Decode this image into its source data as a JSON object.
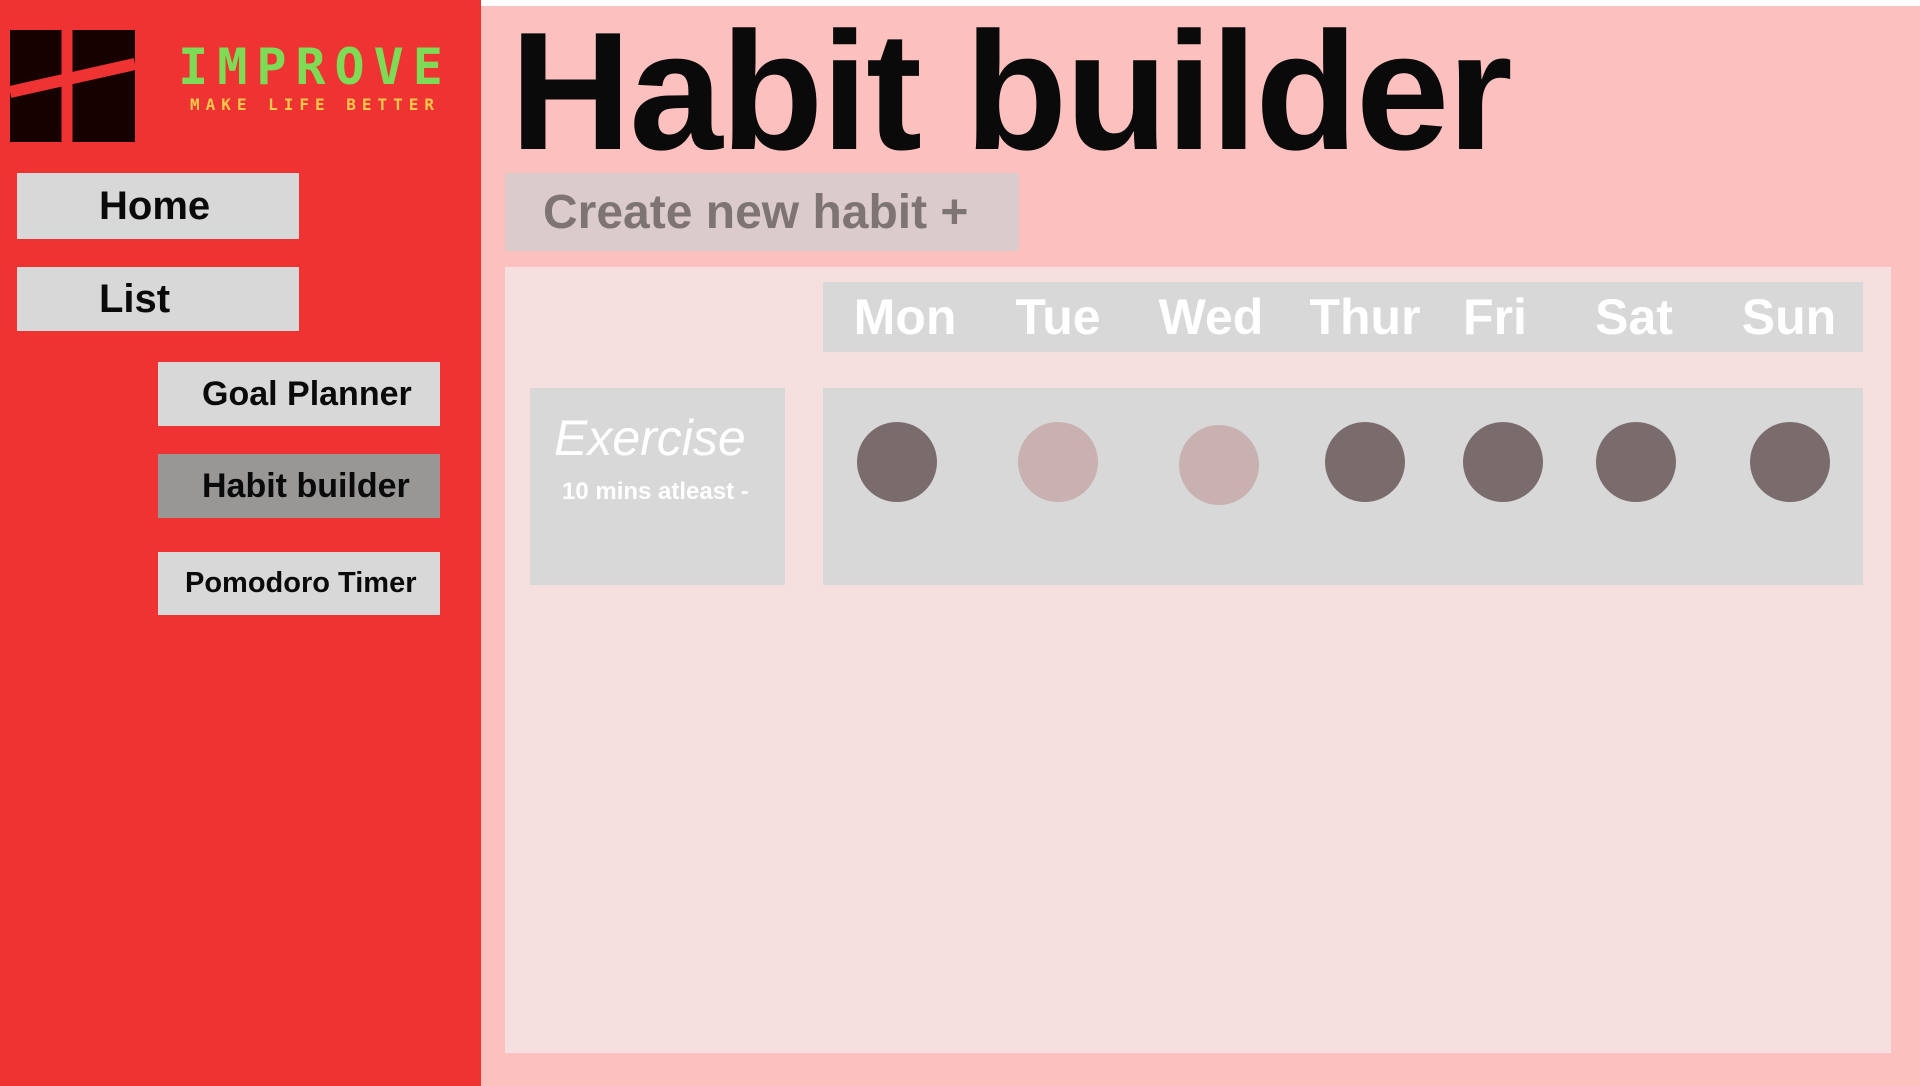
{
  "app": {
    "logo_name": "IMPROVE",
    "logo_tagline": "MAKE LIFE BETTER",
    "logo_icon": "window-grid-icon"
  },
  "sidebar": {
    "items": [
      {
        "label": "Home",
        "active": false
      },
      {
        "label": "List",
        "active": false
      },
      {
        "label": "Goal Planner",
        "active": false
      },
      {
        "label": "Habit builder",
        "active": true
      },
      {
        "label": "Pomodoro Timer",
        "active": false
      }
    ]
  },
  "main": {
    "title": "Habit builder",
    "create_button": "Create new habit +"
  },
  "tracker": {
    "days": [
      "Mon",
      "Tue",
      "Wed",
      "Thur",
      "Fri",
      "Sat",
      "Sun"
    ],
    "habits": [
      {
        "name": "Exercise",
        "detail": "10 mins atleast -",
        "completed": [
          true,
          false,
          false,
          true,
          true,
          true,
          true
        ]
      }
    ]
  },
  "colors": {
    "sidebar_bg": "#ef3333",
    "page_bg": "#fcc0bf",
    "panel_bg": "#f5dfdf",
    "card_bg": "#d8d8d8",
    "active_nav": "#999696",
    "dot_done": "#7a6c6c",
    "dot_pending": "#c9b1b1",
    "logo_green": "#7ddb55",
    "logo_yellow": "#f3c84b"
  }
}
